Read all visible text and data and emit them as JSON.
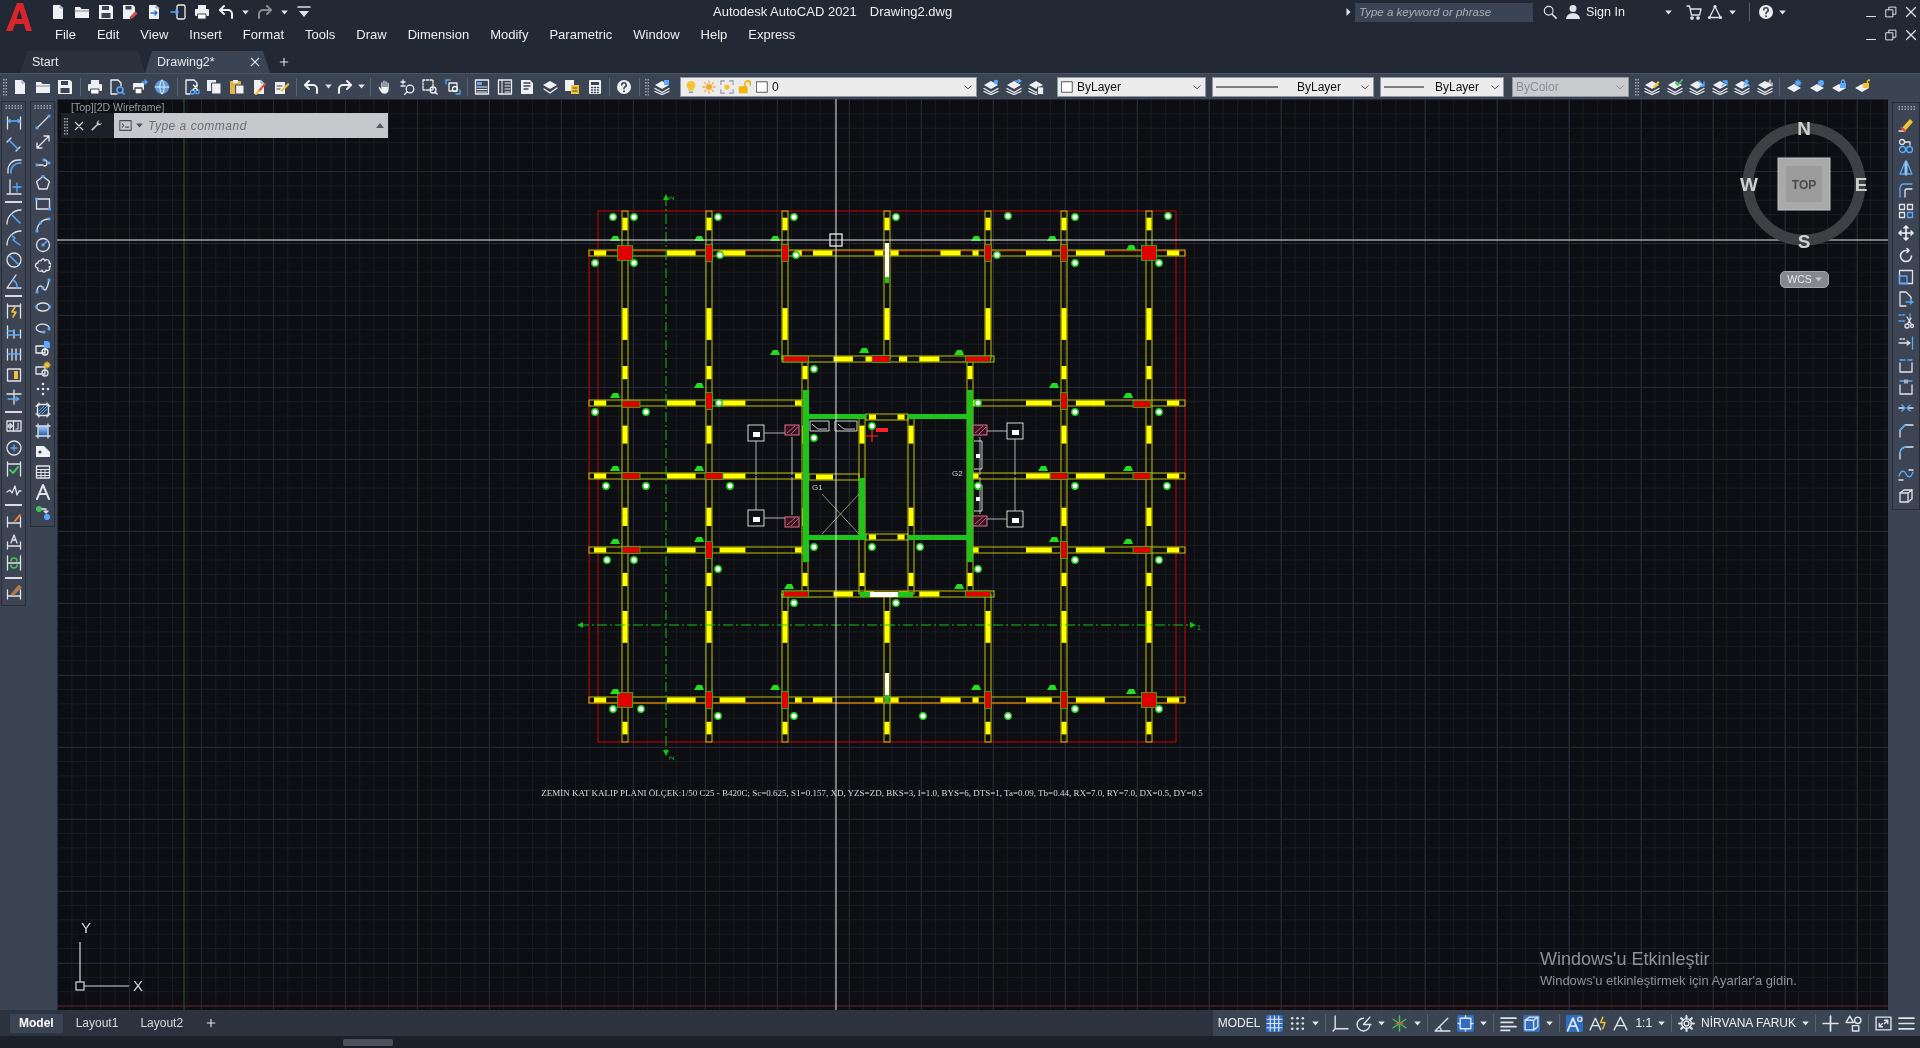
{
  "title_bar": {
    "app_title": "Autodesk AutoCAD 2021",
    "file_name": "Drawing2.dwg",
    "redo_button": {
      "disabled": true
    },
    "search": {
      "placeholder": "Type a keyword or phrase"
    },
    "sign_in": "Sign In"
  },
  "menu_bar": [
    "File",
    "Edit",
    "View",
    "Insert",
    "Format",
    "Tools",
    "Draw",
    "Dimension",
    "Modify",
    "Parametric",
    "Window",
    "Help",
    "Express"
  ],
  "file_tabs": [
    {
      "label": "Start",
      "selected": false
    },
    {
      "label": "Drawing2*",
      "selected": true
    }
  ],
  "properties_toolbar": {
    "layer": "0",
    "object_color": "ByLayer",
    "linetype": "ByLayer",
    "lineweight": "ByLayer",
    "plot_style": {
      "value": "ByColor",
      "disabled": true
    }
  },
  "viewport": {
    "label": "[Top][2D Wireframe]",
    "command_line": {
      "placeholder": "Type a command"
    },
    "plan_labels": [
      "G1",
      "G2"
    ],
    "axis_labels": [
      "2",
      "2",
      "1"
    ],
    "caption": "ZEMİN KAT KALIP PLANI ÖLÇEK:1/50 C25 - B420C; Sc=0.625, S1=0.157, XD, YZS=ZD, BKS=3, I=1.0, BYS=6, DTS=1, Ta=0.09, Tb=0.44, RX=7.0, RY=7.0, DX=0.5, DY=0.5",
    "view_cube": {
      "face": "TOP",
      "north": "N",
      "south": "S",
      "east": "E",
      "west": "W",
      "coordinate_system": "WCS"
    },
    "ucs_icon": {
      "x_label": "X",
      "y_label": "Y"
    },
    "activation_notice": {
      "title": "Windows'u Etkinleştir",
      "text": "Windows'u etkinleştirmek için Ayarlar'a gidin."
    }
  },
  "layout_tabs": [
    {
      "label": "Model",
      "selected": true
    },
    {
      "label": "Layout1",
      "selected": false
    },
    {
      "label": "Layout2",
      "selected": false
    }
  ],
  "status_bar": {
    "space": "MODEL",
    "toggles": [
      {
        "kind": "grid",
        "on": true
      },
      {
        "kind": "snap",
        "on": false
      },
      {
        "kind": "ortho",
        "on": false
      },
      {
        "kind": "polar",
        "on": false
      },
      {
        "kind": "isodraft",
        "on": false
      },
      {
        "kind": "tracking",
        "on": false
      },
      {
        "kind": "osnap",
        "on": true
      },
      {
        "kind": "lineweight",
        "on": false
      },
      {
        "kind": "osnap3d",
        "on": true
      },
      {
        "kind": "annotation_visibility",
        "on": true
      },
      {
        "kind": "autoscale",
        "on": false
      }
    ],
    "annotation_scale": "1:1",
    "workspace": "NİRVANA FARUK"
  }
}
